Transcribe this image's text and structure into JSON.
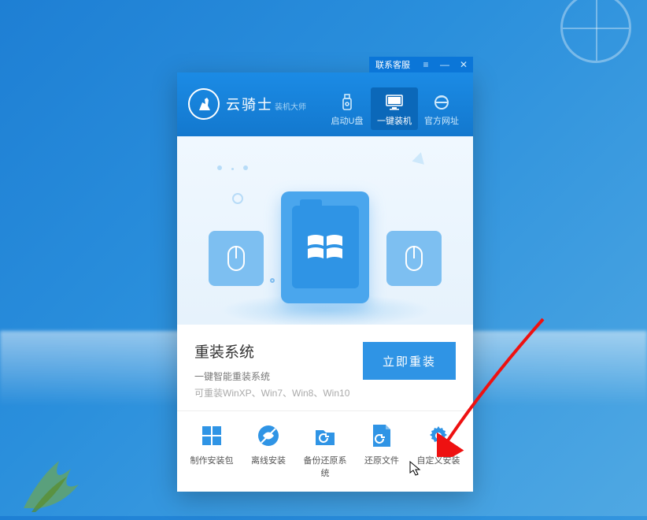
{
  "app": {
    "name": "云骑士",
    "subtitle": "装机大师",
    "contact_label": "联系客服"
  },
  "header_nav": [
    {
      "key": "usb",
      "label": "启动U盘",
      "active": false
    },
    {
      "key": "oneclick",
      "label": "一键装机",
      "active": true
    },
    {
      "key": "site",
      "label": "官方网址",
      "active": false
    }
  ],
  "action": {
    "title": "重装系统",
    "subtitle": "一键智能重装系统",
    "supports": "可重装WinXP、Win7、Win8、Win10",
    "cta": "立即重装"
  },
  "tools": [
    {
      "key": "package",
      "label": "制作安装包"
    },
    {
      "key": "offline",
      "label": "离线安装"
    },
    {
      "key": "backup",
      "label": "备份还原系统"
    },
    {
      "key": "restore",
      "label": "还原文件"
    },
    {
      "key": "custom",
      "label": "自定义安装"
    }
  ]
}
